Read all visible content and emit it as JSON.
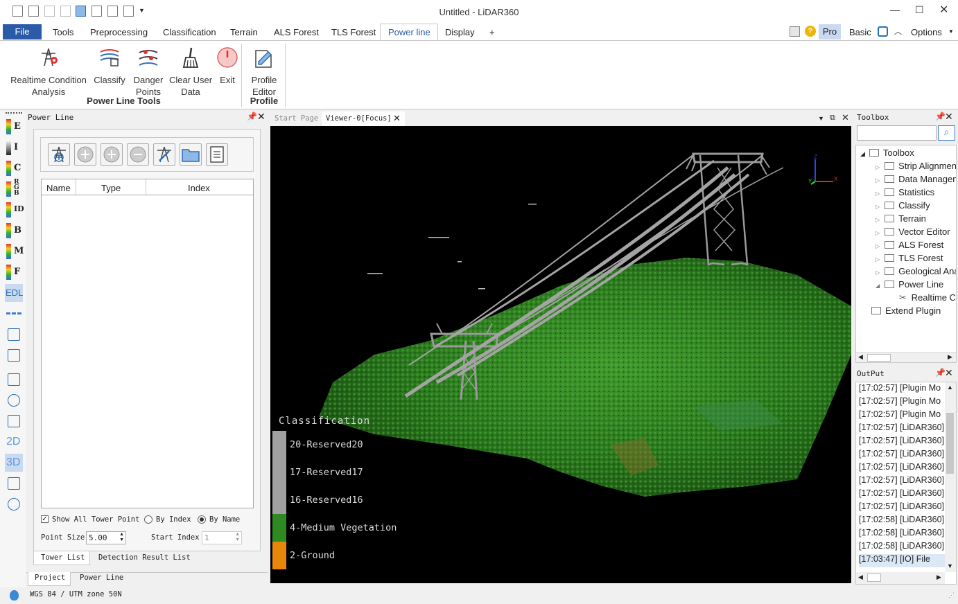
{
  "window": {
    "title": "Untitled - LiDAR360"
  },
  "menu": {
    "items": [
      "File",
      "Tools",
      "Preprocessing",
      "Classification",
      "Terrain",
      "ALS Forest",
      "TLS Forest",
      "Power line",
      "Display",
      "+"
    ],
    "right": {
      "pro": "Pro",
      "basic": "Basic",
      "options": "Options"
    }
  },
  "ribbon": {
    "buttons": [
      {
        "label1": "Realtime Condition",
        "label2": "Analysis"
      },
      {
        "label1": "Classify",
        "label2": ""
      },
      {
        "label1": "Danger",
        "label2": "Points"
      },
      {
        "label1": "Clear User",
        "label2": "Data"
      },
      {
        "label1": "Exit",
        "label2": ""
      },
      {
        "label1": "Profile",
        "label2": "Editor"
      }
    ],
    "group1": "Power Line Tools",
    "group2": "Profile"
  },
  "vbar": {
    "labels": [
      "E",
      "I",
      "C",
      "R\nG\nB",
      "ID",
      "B",
      "M",
      "F",
      "EDL",
      "",
      "",
      "",
      "",
      "",
      "",
      "2D",
      "3D",
      "",
      ""
    ]
  },
  "left_panel": {
    "title": "Power Line",
    "columns": [
      "Name",
      "Type",
      "Index"
    ],
    "show_all": "Show All Tower Point",
    "by_index": "By Index",
    "by_name": "By Name",
    "point_size_label": "Point Size",
    "point_size": "5.00",
    "start_index_label": "Start Index",
    "start_index": "1",
    "tabs": [
      "Tower List",
      "Detection Result List"
    ],
    "bottom_tabs": [
      "Project",
      "Power Line"
    ]
  },
  "viewer": {
    "tabs": [
      "Start Page",
      "Viewer-0[Focus]"
    ],
    "legend_title": "Classification",
    "legend": [
      {
        "label": "20-Reserved20",
        "color": "#a0a0a0"
      },
      {
        "label": "17-Reserved17",
        "color": "#a0a0a0"
      },
      {
        "label": "16-Reserved16",
        "color": "#a0a0a0"
      },
      {
        "label": "4-Medium Vegetation",
        "color": "#2e8b22"
      },
      {
        "label": "2-Ground",
        "color": "#e8860a"
      }
    ],
    "axes": {
      "x": "X",
      "y": "Y",
      "z": "Z"
    }
  },
  "toolbox": {
    "title": "Toolbox",
    "root": "Toolbox",
    "items": [
      "Strip Alignment",
      "Data Management",
      "Statistics",
      "Classify",
      "Terrain",
      "Vector Editor",
      "ALS Forest",
      "TLS Forest",
      "Geological Analysis",
      "Power Line"
    ],
    "child": "Realtime Condition Analysis",
    "extend": "Extend Plugin"
  },
  "output": {
    "title": "OutPut",
    "lines": [
      "[17:02:57] [Plugin Mo",
      "[17:02:57] [Plugin Mo",
      "[17:02:57] [Plugin Mo",
      "[17:02:57] [LiDAR360]",
      "[17:02:57] [LiDAR360]",
      "[17:02:57] [LiDAR360]",
      "[17:02:57] [LiDAR360]",
      "[17:02:57] [LiDAR360]",
      "[17:02:57] [LiDAR360]",
      "[17:02:57] [LiDAR360]",
      "[17:02:58] [LiDAR360]",
      "[17:02:58] [LiDAR360]",
      "[17:02:58] [LiDAR360]",
      "[17:03:47] [IO]    File"
    ]
  },
  "status": {
    "crs": "WGS 84 / UTM zone 50N"
  }
}
